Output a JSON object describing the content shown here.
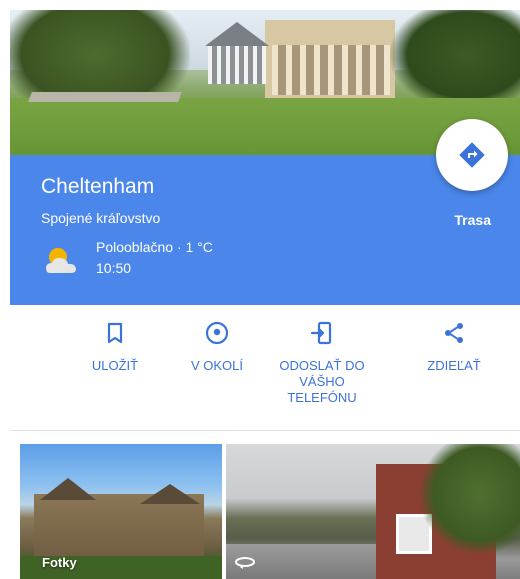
{
  "header": {
    "place_name": "Cheltenham",
    "country": "Spojené kráľovstvo",
    "weather": {
      "description": "Polooblačno · 1 °C",
      "time": "10:50",
      "icon": "partly-cloudy-icon"
    },
    "route_label": "Trasa",
    "route_icon": "directions-icon"
  },
  "actions": [
    {
      "icon": "bookmark-icon",
      "label": "ULOŽIŤ"
    },
    {
      "icon": "location-pin-icon",
      "label": "V OKOLÍ"
    },
    {
      "icon": "send-to-phone-icon",
      "label": "ODOSLAŤ DO VÁŠHO TELEFÓNU"
    },
    {
      "icon": "share-icon",
      "label": "ZDIEĽAŤ"
    }
  ],
  "gallery": {
    "photos_label": "Fotky",
    "street_view_icon": "street-view-360-icon"
  },
  "colors": {
    "header_blue": "#4b86ea",
    "accent_blue": "#3b73d9"
  }
}
